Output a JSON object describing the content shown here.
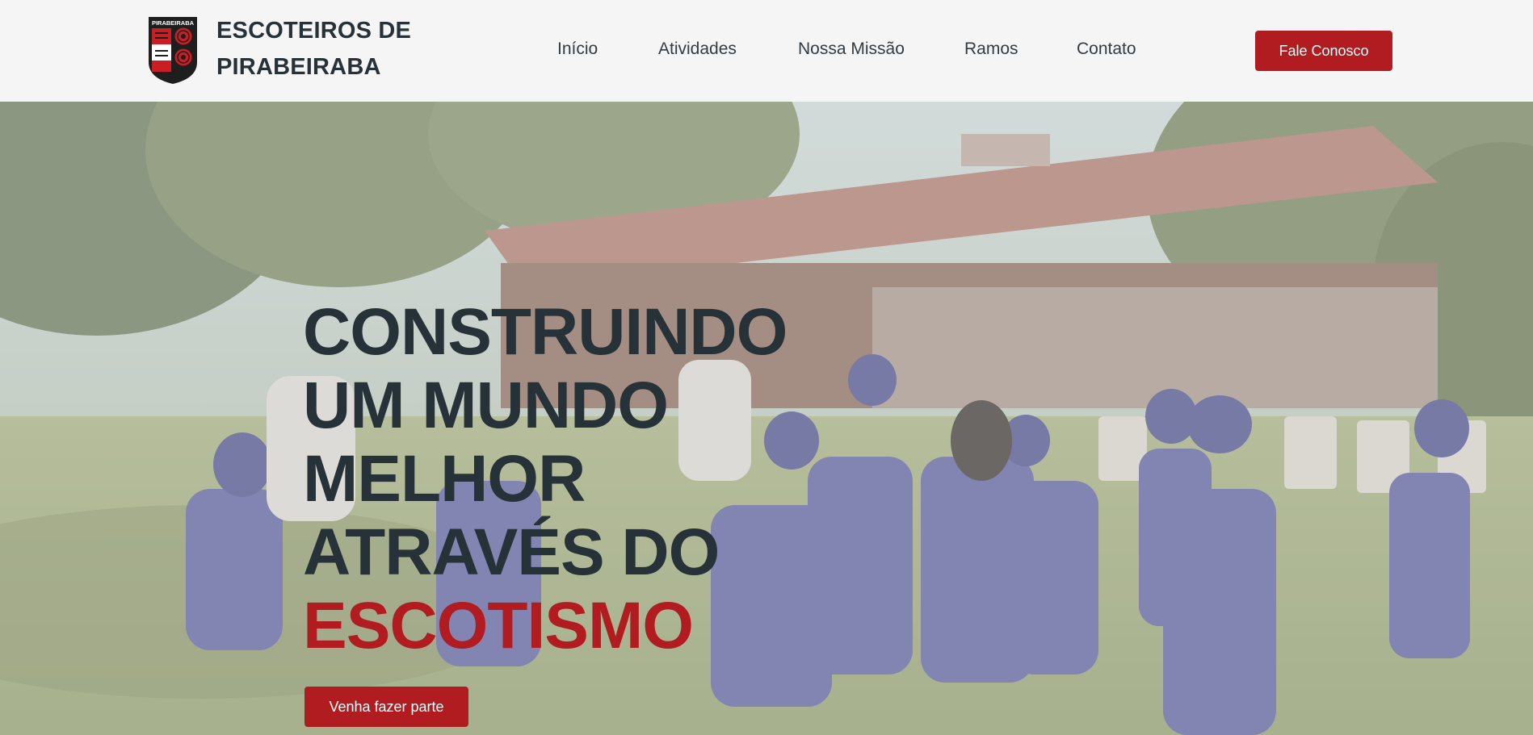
{
  "header": {
    "logo_text": "PIRABEIRABA",
    "brand_line1": "ESCOTEIROS DE",
    "brand_line2": "PIRABEIRABA",
    "nav": [
      "Início",
      "Atividades",
      "Nossa Missão",
      "Ramos",
      "Contato"
    ],
    "cta_label": "Fale Conosco"
  },
  "hero": {
    "headline_lines": [
      "CONSTRUINDO",
      "UM MUNDO",
      "MELHOR",
      "ATRAVÉS DO"
    ],
    "headline_accent": "ESCOTISMO",
    "button_label": "Venha fazer parte"
  },
  "colors": {
    "accent": "#b01c1f",
    "text_dark": "#263238",
    "header_bg": "#f5f5f5"
  }
}
